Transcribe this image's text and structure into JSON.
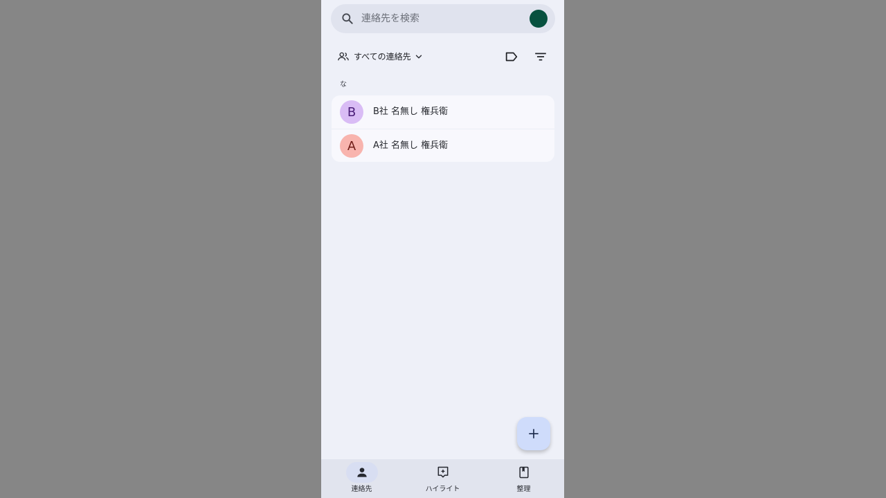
{
  "search": {
    "placeholder": "連絡先を検索",
    "account_color": "#07513f"
  },
  "filter": {
    "label": "すべての連絡先",
    "icons": [
      "people-icon",
      "chevron-down-icon",
      "label-icon",
      "sort-icon"
    ]
  },
  "section": {
    "header": "な"
  },
  "contacts": [
    {
      "initial": "B",
      "name": "B社 名無し 権兵衛",
      "avatar_bg": "#d9bcf5",
      "avatar_fg": "#4a1d78"
    },
    {
      "initial": "A",
      "name": "A社 名無し 権兵衛",
      "avatar_bg": "#f8b4ae",
      "avatar_fg": "#6f1c17"
    }
  ],
  "fab": {
    "icon": "plus-icon"
  },
  "bottom_nav": [
    {
      "label": "連絡先",
      "icon": "person-icon",
      "selected": true
    },
    {
      "label": "ハイライト",
      "icon": "highlight-icon",
      "selected": false
    },
    {
      "label": "整理",
      "icon": "organize-icon",
      "selected": false
    }
  ]
}
